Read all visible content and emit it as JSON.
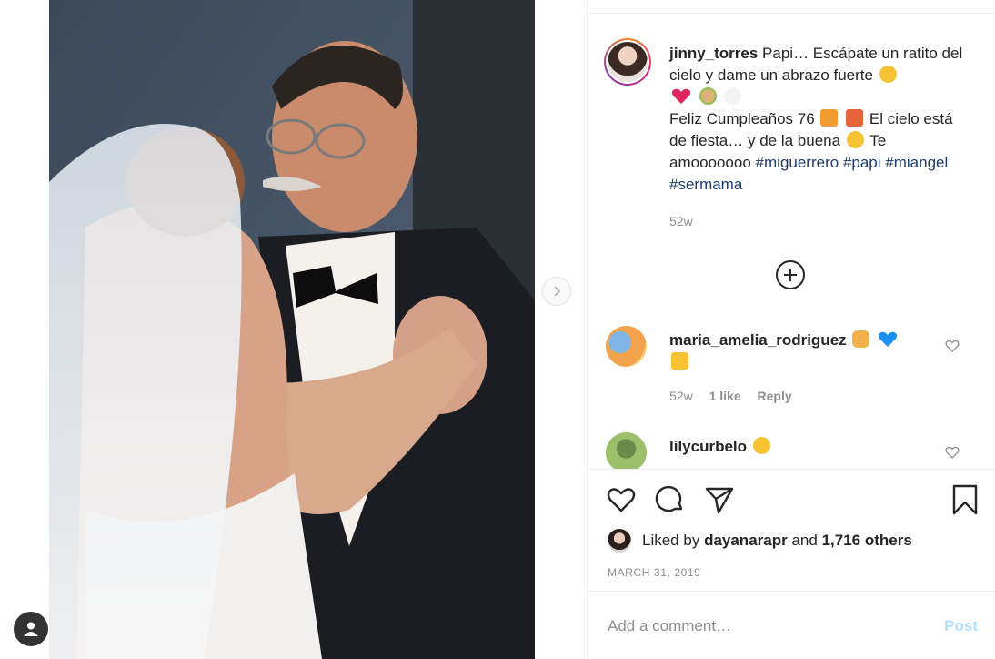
{
  "post": {
    "username": "jinny_torres",
    "caption_line1": "Papi… Escápate un ratito del cielo y dame un abrazo fuerte",
    "caption_line2": "Feliz Cumpleaños 76",
    "caption_line3": "El cielo está de fiesta… y de la buena",
    "caption_line4": "Te amooooooo",
    "hashtags": [
      "#miguerrero",
      "#papi",
      "#miangel",
      "#sermama"
    ],
    "time": "52w"
  },
  "comments": [
    {
      "username": "maria_amelia_rodriguez",
      "time": "52w",
      "likes": "1 like",
      "reply": "Reply"
    },
    {
      "username": "lilycurbelo"
    }
  ],
  "likes": {
    "prefix": "Liked by",
    "user": "dayanarapr",
    "and": "and",
    "others": "1,716 others"
  },
  "date": "MARCH 31, 2019",
  "add_comment": {
    "placeholder": "Add a comment…",
    "post_label": "Post"
  },
  "icons": {
    "like": "heart-icon",
    "comment": "comment-icon",
    "share": "paper-plane-icon",
    "save": "bookmark-icon",
    "load_more": "plus-circle-icon",
    "next": "chevron-right-icon",
    "profile": "user-icon"
  }
}
